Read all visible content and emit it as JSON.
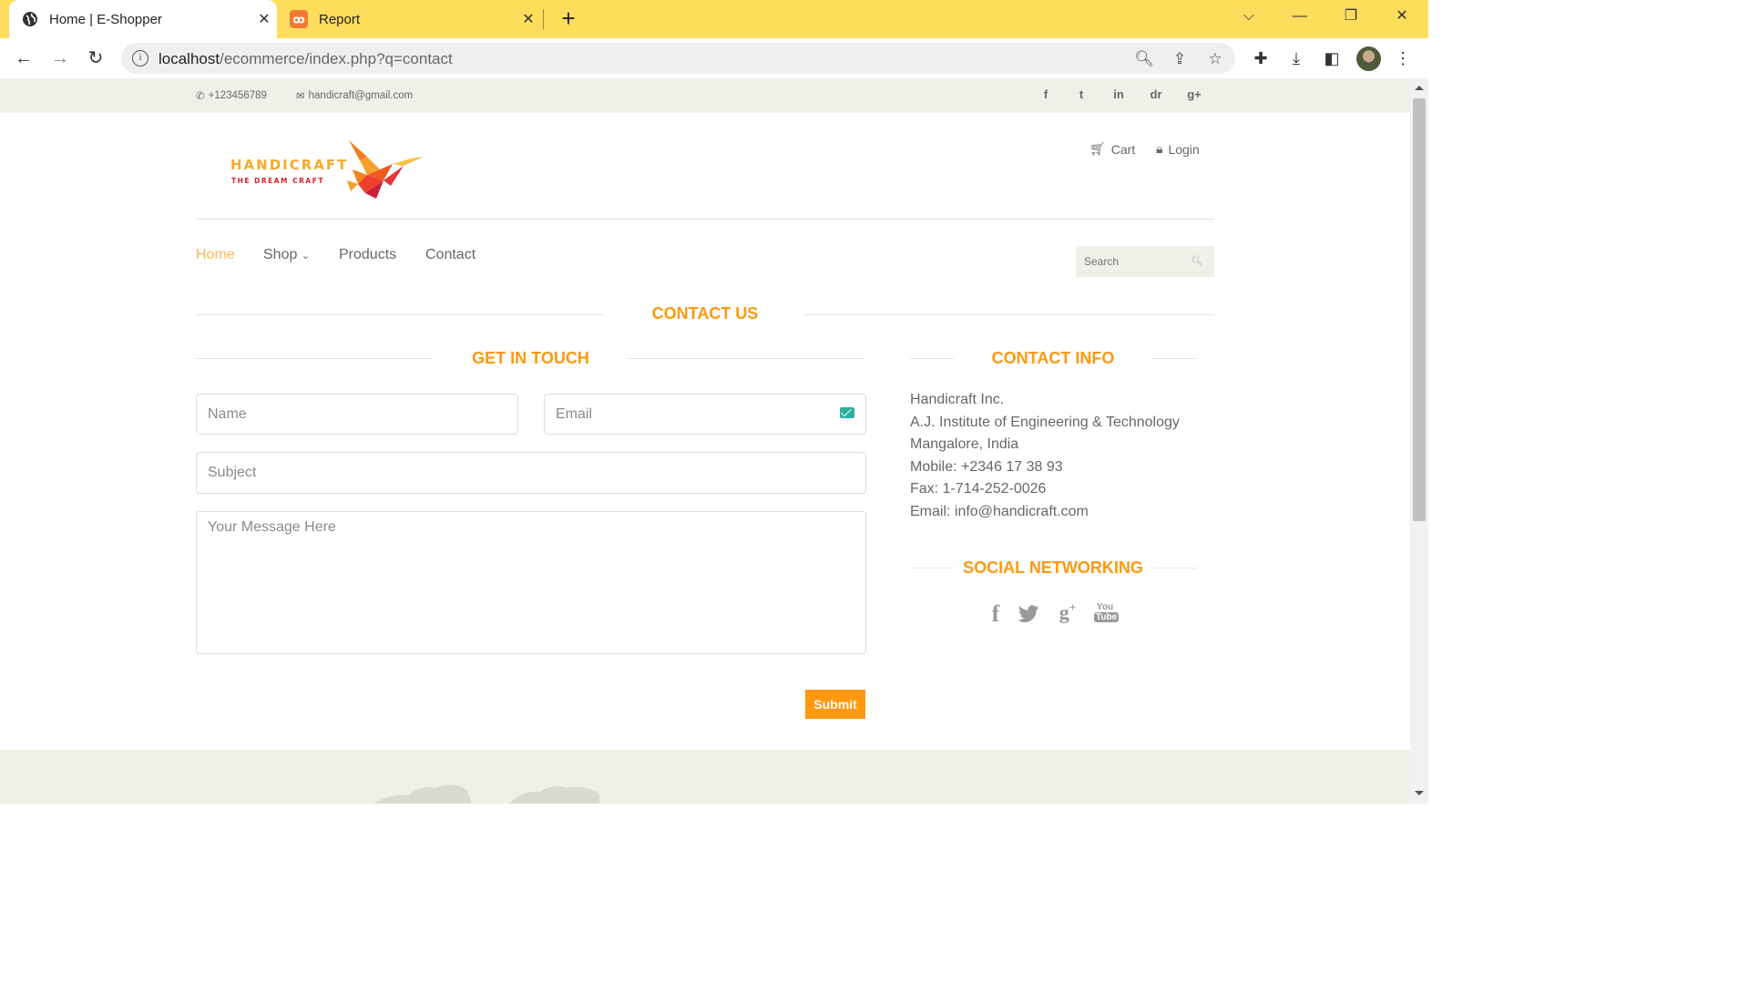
{
  "browser": {
    "tabs": [
      {
        "title": "Home | E-Shopper",
        "icon": "globe-icon",
        "active": true
      },
      {
        "title": "Report",
        "icon": "xampp-icon",
        "active": false
      }
    ],
    "url_host": "localhost",
    "url_path": "/ecommerce/index.php?q=contact"
  },
  "topbar": {
    "phone": "+123456789",
    "email": "handicraft@gmail.com",
    "social": [
      "f",
      "t",
      "in",
      "dr",
      "g+"
    ]
  },
  "logo": {
    "brand": "HANDICRAFT",
    "tagline": "THE DREAM CRAFT"
  },
  "header": {
    "cart_label": "Cart",
    "login_label": "Login"
  },
  "nav": {
    "items": [
      "Home",
      "Shop",
      "Products",
      "Contact"
    ],
    "search_placeholder": "Search"
  },
  "contact": {
    "title": "CONTACT US",
    "form_title": "GET IN TOUCH",
    "name_placeholder": "Name",
    "email_placeholder": "Email",
    "subject_placeholder": "Subject",
    "message_placeholder": "Your Message Here",
    "submit_label": "Submit"
  },
  "contact_info": {
    "title": "CONTACT INFO",
    "lines": [
      "Handicraft Inc.",
      "A.J. Institute of Engineering & Technology",
      "Mangalore, India",
      "Mobile: +2346 17 38 93",
      "Fax: 1-714-252-0026",
      "Email: info@handicraft.com"
    ],
    "social_title": "SOCIAL NETWORKING"
  },
  "colors": {
    "accent": "#FE980F",
    "nav_active": "#FDB45E",
    "text": "#696763",
    "tabbar": "#FEDD5C"
  }
}
